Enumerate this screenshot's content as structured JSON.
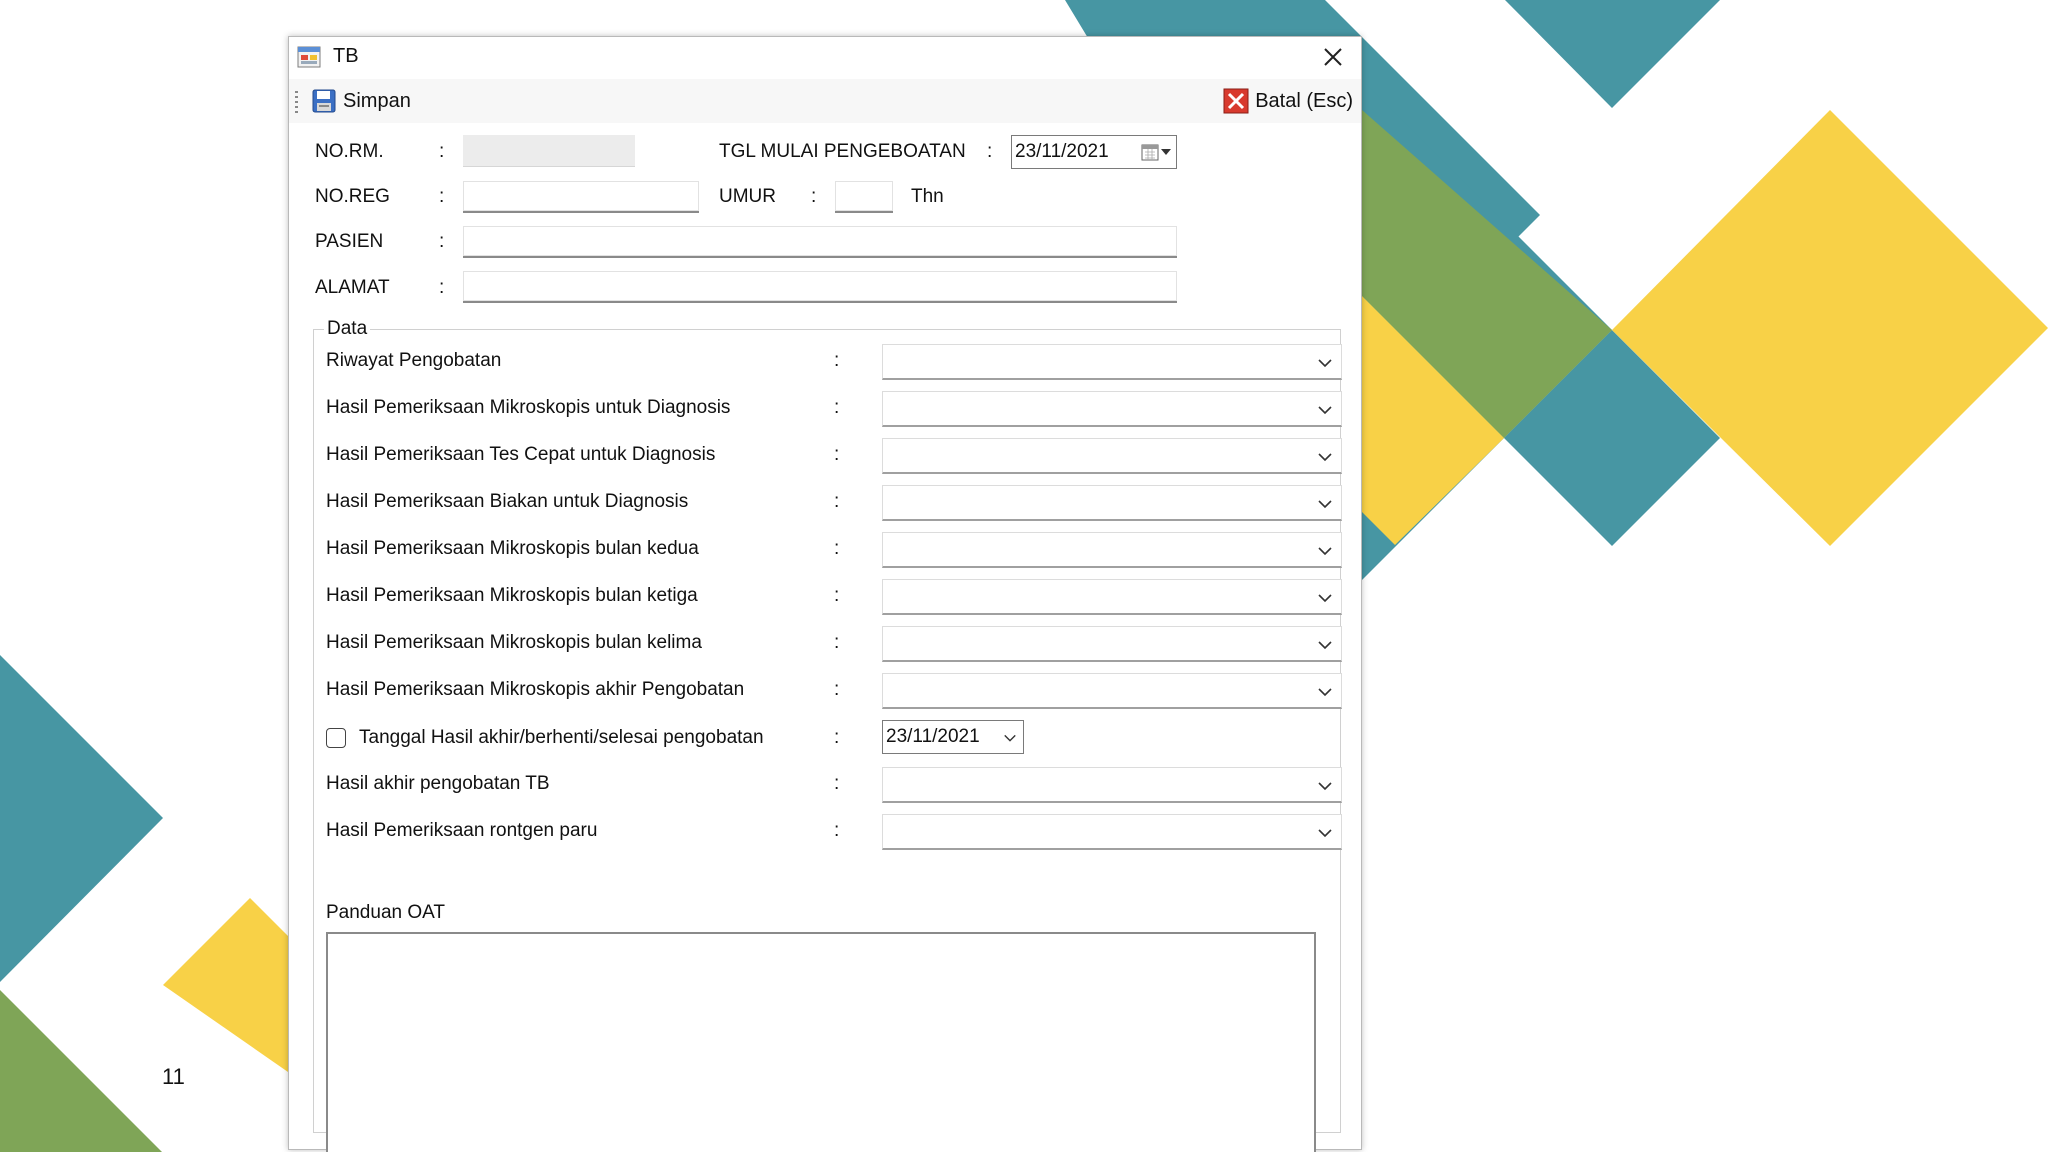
{
  "slide": {
    "number": "11"
  },
  "window": {
    "title": "TB",
    "close_icon": "close-icon",
    "app_icon": "form-icon"
  },
  "toolbar": {
    "save_label": "Simpan",
    "save_icon": "floppy-disk-icon",
    "cancel_label": "Batal (Esc)",
    "cancel_icon": "red-x-icon"
  },
  "header_fields": {
    "norm": {
      "label": "NO.RM.",
      "value": ""
    },
    "noreg": {
      "label": "NO.REG",
      "value": ""
    },
    "pasien": {
      "label": "PASIEN",
      "value": ""
    },
    "alamat": {
      "label": "ALAMAT",
      "value": ""
    },
    "tgl_mulai": {
      "label": "TGL MULAI PENGEBOATAN",
      "value": "23/11/2021"
    },
    "umur": {
      "label": "UMUR",
      "value": "",
      "unit": "Thn"
    },
    "colon": ":"
  },
  "group": {
    "title": "Data",
    "rows": [
      {
        "label": "Riwayat Pengobatan",
        "value": ""
      },
      {
        "label": "Hasil Pemeriksaan Mikroskopis untuk Diagnosis",
        "value": ""
      },
      {
        "label": "Hasil Pemeriksaan Tes Cepat untuk Diagnosis",
        "value": ""
      },
      {
        "label": "Hasil Pemeriksaan Biakan untuk Diagnosis",
        "value": ""
      },
      {
        "label": "Hasil Pemeriksaan Mikroskopis bulan kedua",
        "value": ""
      },
      {
        "label": "Hasil Pemeriksaan Mikroskopis bulan ketiga",
        "value": ""
      },
      {
        "label": "Hasil Pemeriksaan Mikroskopis bulan kelima",
        "value": ""
      },
      {
        "label": "Hasil Pemeriksaan Mikroskopis akhir Pengobatan",
        "value": ""
      }
    ],
    "tanggal_hasil": {
      "label": "Tanggal Hasil akhir/berhenti/selesai pengobatan",
      "value": "23/11/2021",
      "checked": false
    },
    "rows_after": [
      {
        "label": "Hasil akhir pengobatan TB",
        "value": ""
      },
      {
        "label": "Hasil Pemeriksaan rontgen paru",
        "value": ""
      }
    ],
    "panduan_label": "Panduan OAT",
    "panduan_value": ""
  },
  "colors": {
    "teal": "#4796A3",
    "green": "#7FA557",
    "yellow": "#F8D147"
  }
}
